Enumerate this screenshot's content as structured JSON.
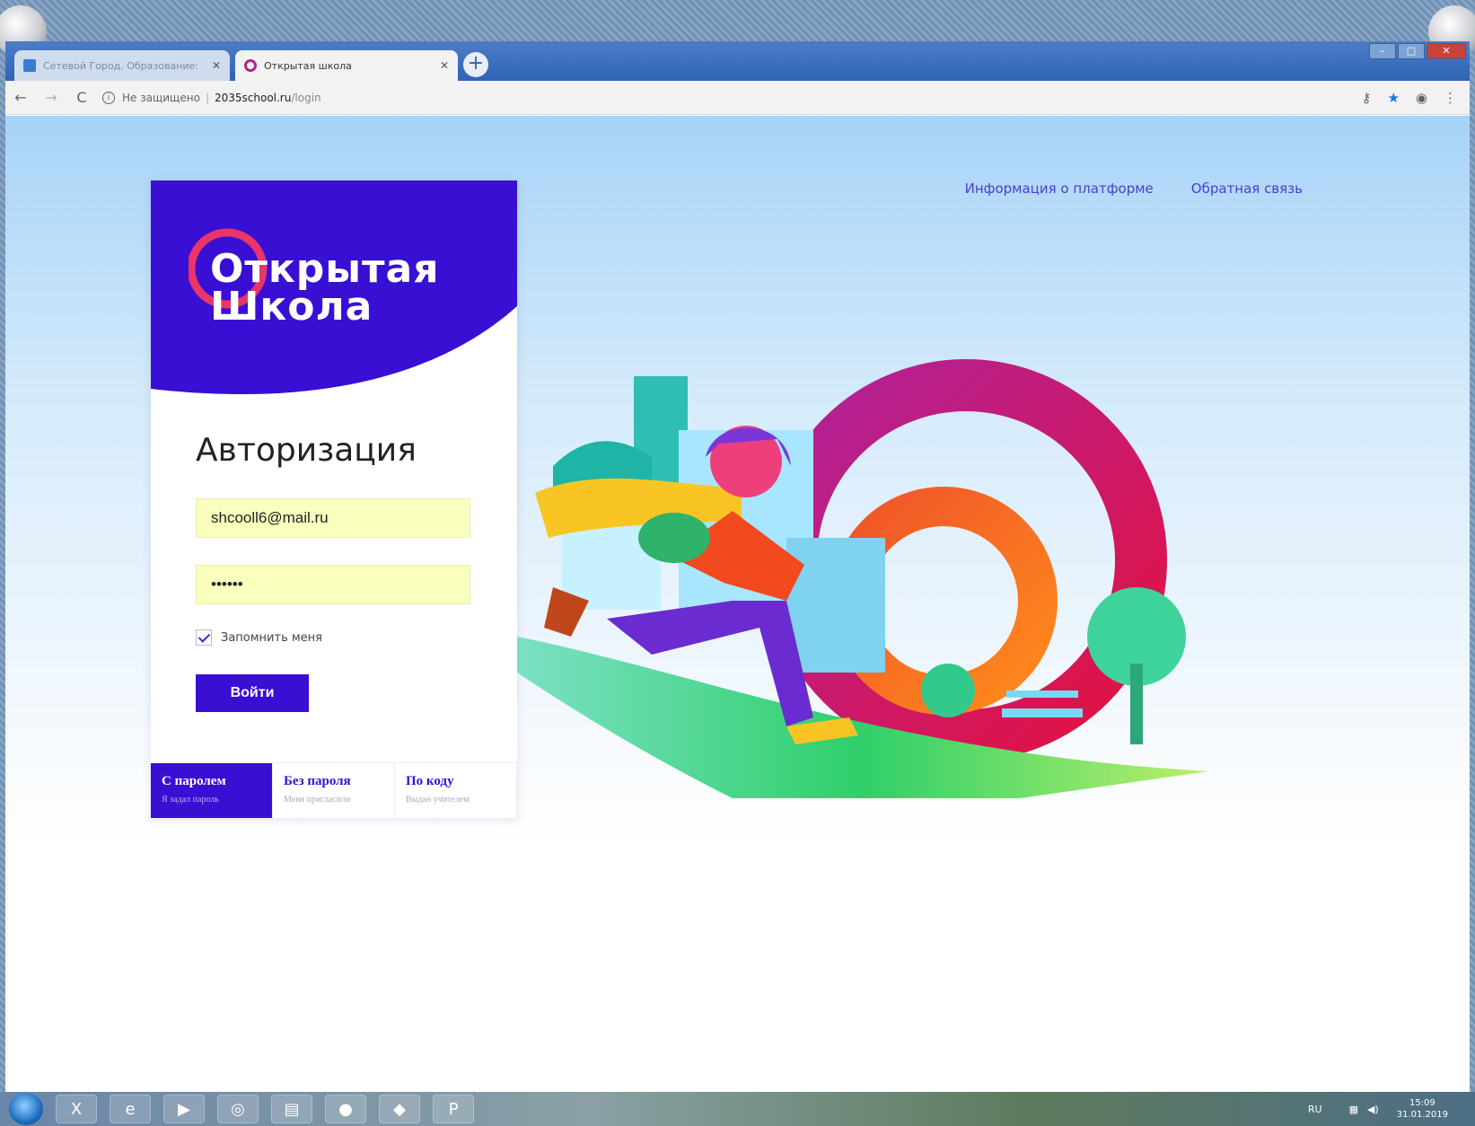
{
  "browser": {
    "tabs": [
      {
        "title": "Сетевой Город. Образование: ",
        "active": false,
        "favicon": "blue-square-icon"
      },
      {
        "title": "Открытая школа",
        "active": true,
        "favicon": "ring-icon"
      }
    ],
    "address": {
      "security": "Не защищено",
      "host": "2035school.ru",
      "path": "/login"
    }
  },
  "page": {
    "nav": {
      "info_link": "Информация о платформе",
      "feedback_link": "Обратная связь"
    },
    "logo": {
      "line1": "Открытая",
      "line2": "Школа"
    },
    "form": {
      "heading": "Авторизация",
      "email_value": "shcooll6@mail.ru",
      "password_value": "••••••",
      "remember_label": "Запомнить меня",
      "remember_checked": true,
      "submit_label": "Войти"
    },
    "modes": [
      {
        "title": "С паролем",
        "subtitle": "Я задал пароль",
        "active": true
      },
      {
        "title": "Без пароля",
        "subtitle": "Меня пригласили",
        "active": false
      },
      {
        "title": "По коду",
        "subtitle": "Выдан учителем",
        "active": false
      }
    ]
  },
  "taskbar": {
    "lang": "RU",
    "time": "15:09",
    "date": "31.01.2019"
  },
  "colors": {
    "brand_purple": "#3a0fd4",
    "logo_ring": "#e8356a",
    "autofill": "#faffbd"
  }
}
